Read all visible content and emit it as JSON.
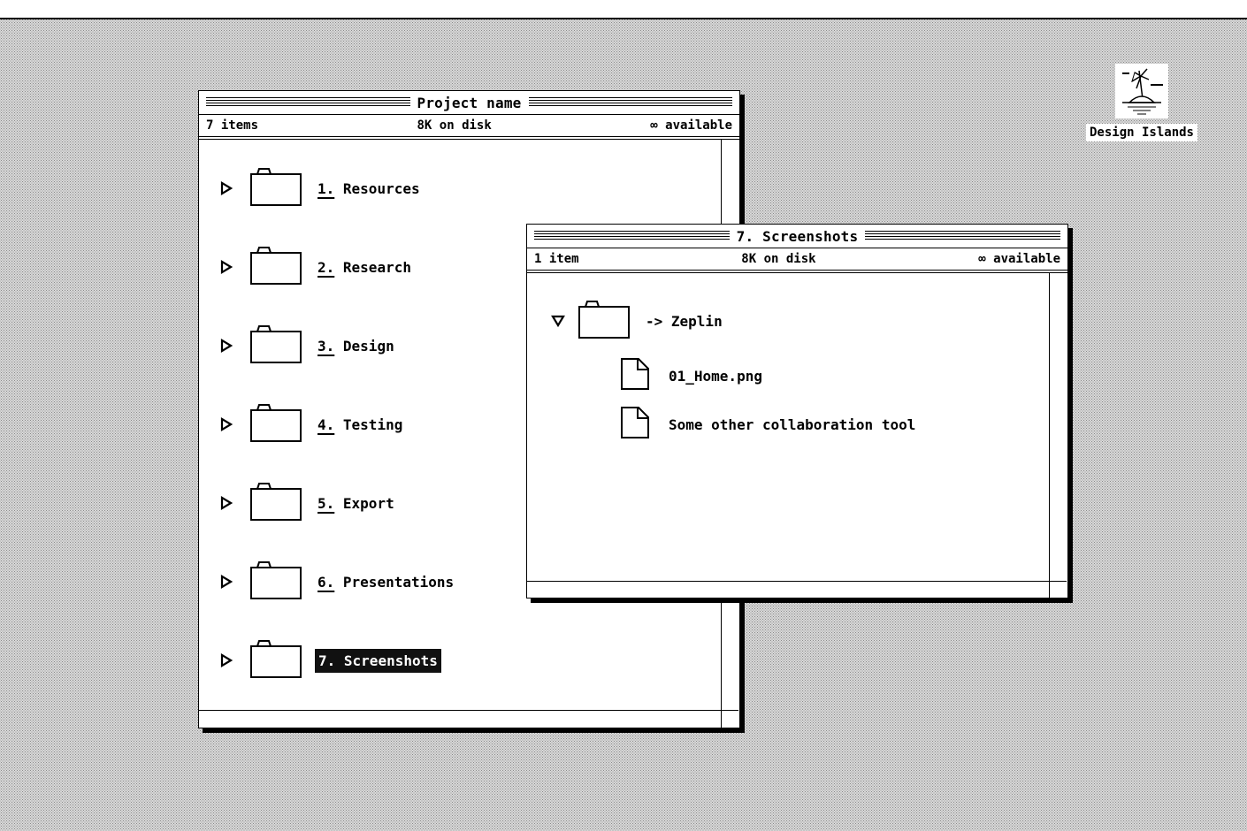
{
  "desktop": {
    "icon_label": "Design Islands"
  },
  "window_main": {
    "title": "Project name",
    "items_count": "7 items",
    "disk": "8K on disk",
    "available": "∞ available",
    "items": [
      {
        "num": "1.",
        "label": "Resources"
      },
      {
        "num": "2.",
        "label": "Research"
      },
      {
        "num": "3.",
        "label": "Design"
      },
      {
        "num": "4.",
        "label": "Testing"
      },
      {
        "num": "5.",
        "label": "Export"
      },
      {
        "num": "6.",
        "label": "Presentations"
      },
      {
        "num": "7.",
        "label": "Screenshots"
      }
    ]
  },
  "window_sub": {
    "title": "7. Screenshots",
    "items_count": "1 item",
    "disk": "8K on disk",
    "available": "∞ available",
    "folder": "-> Zeplin",
    "files": [
      {
        "label": "01_Home.png"
      },
      {
        "label": "Some other collaboration tool"
      }
    ]
  },
  "colors": {
    "selection": "#111111",
    "window_bg": "#ffffff"
  }
}
